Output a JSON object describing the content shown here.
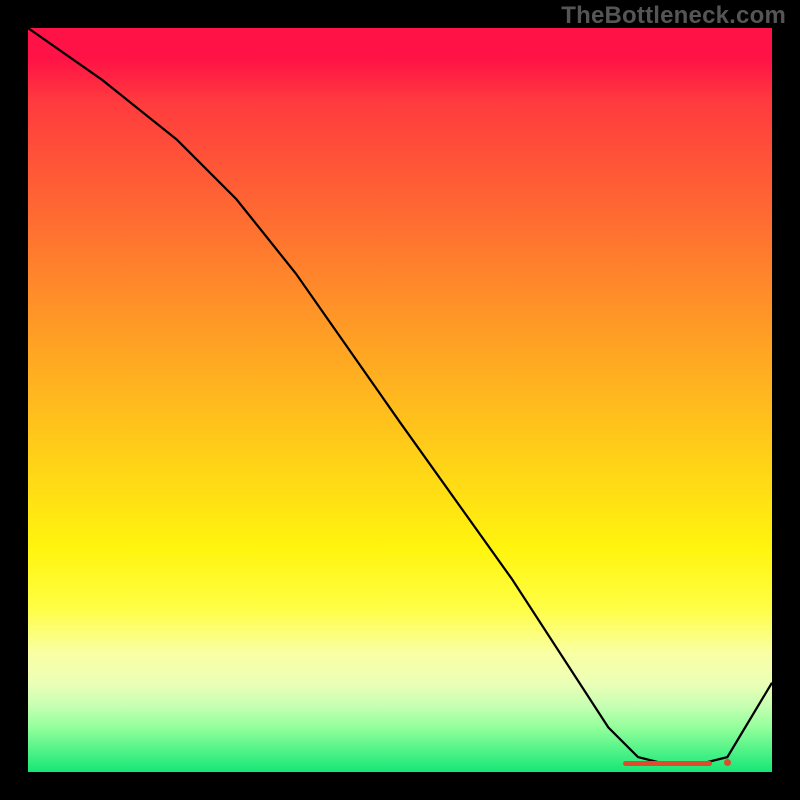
{
  "watermark": "TheBottleneck.com",
  "chart_data": {
    "type": "line",
    "title": "",
    "xlabel": "",
    "ylabel": "",
    "xlim": [
      0,
      1
    ],
    "ylim": [
      0,
      1
    ],
    "series": [
      {
        "name": "curve",
        "x": [
          0.0,
          0.1,
          0.2,
          0.28,
          0.36,
          0.5,
          0.65,
          0.78,
          0.82,
          0.86,
          0.9,
          0.94,
          1.0
        ],
        "y": [
          1.0,
          0.93,
          0.85,
          0.77,
          0.67,
          0.47,
          0.26,
          0.06,
          0.02,
          0.01,
          0.01,
          0.02,
          0.12
        ]
      }
    ],
    "markers": {
      "valley_bar": {
        "x0": 0.8,
        "x1": 0.92,
        "y": 0.012
      },
      "valley_dot": {
        "x": 0.935,
        "y": 0.014
      }
    },
    "background_gradient": {
      "top": "#ff1246",
      "bottom": "#14e776"
    }
  }
}
